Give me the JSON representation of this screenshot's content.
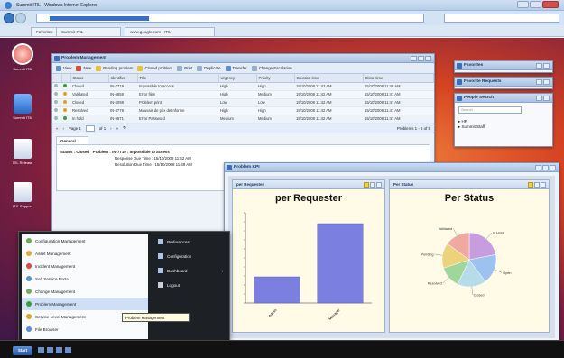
{
  "browser": {
    "title": "Summit ITIL - Windows Internet Explorer",
    "url": "http://www.example.com/summit",
    "search_placeholder": "Google",
    "tabs": [
      "Favorites",
      "Summit ITIL",
      "www.google.com - ITIL"
    ]
  },
  "desktop_icons": [
    {
      "label": "Summit ITIL",
      "kind": "orb"
    },
    {
      "label": "Summit ITIL",
      "kind": "man"
    },
    {
      "label": "ITIL Release",
      "kind": "sheet"
    },
    {
      "label": "ITIL Support",
      "kind": "sheet"
    }
  ],
  "problem_window": {
    "title": "Problem Management",
    "toolbar": [
      "View",
      "New",
      "Pending problem",
      "Closed problem",
      "Print",
      "Duplicate",
      "Transfer",
      "Change Escalation"
    ],
    "columns": [
      "",
      "",
      "Status",
      "Identifier",
      "Title",
      "Urgency",
      "Priority",
      "Creation time",
      "Close time"
    ],
    "rows": [
      {
        "dot": "#3a9e3a",
        "status": "Closed",
        "id": "IN-7719",
        "title": "Impossible to access",
        "urgency": "High",
        "priority": "High",
        "created": "15/10/2008 11:42 AM",
        "closed": "15/10/2008 11:48 AM"
      },
      {
        "dot": "#e0a020",
        "status": "Validated",
        "id": "IN-6858",
        "title": "Error files",
        "urgency": "High",
        "priority": "Medium",
        "created": "15/10/2008 11:42 AM",
        "closed": "15/10/2008 11:47 AM"
      },
      {
        "dot": "#e0a020",
        "status": "Closed",
        "id": "IN-5098",
        "title": "Problem print",
        "urgency": "Low",
        "priority": "Low",
        "created": "15/10/2008 11:42 AM",
        "closed": "15/10/2008 11:47 AM"
      },
      {
        "dot": "#e0a020",
        "status": "Resolved",
        "id": "IN-3778",
        "title": "Mauvais de prix de Informe",
        "urgency": "High",
        "priority": "High",
        "created": "15/10/2008 11:42 AM",
        "closed": "15/10/2008 11:47 AM"
      },
      {
        "dot": "#3a9e3a",
        "status": "In hold",
        "id": "IN-9671",
        "title": "Error Password",
        "urgency": "Medium",
        "priority": "Medium",
        "created": "15/10/2008 11:42 AM",
        "closed": "15/10/2008 11:47 AM"
      }
    ],
    "pager": {
      "page": "Page 1",
      "of": "of 1",
      "display": "Problems 1 - 5 of 5"
    },
    "general_tab": "General",
    "detail": {
      "status": "Status : Closed",
      "problem": "Problem : IN-7719 : Impossible to access",
      "response": "Response Due Time : 15/10/2008 11:42 AM",
      "resolution": "Resolution Due Time : 15/10/2008 11:48 AM"
    }
  },
  "right_widgets": [
    {
      "title": "Favorites"
    },
    {
      "title": "Favorite Requests"
    },
    {
      "title": "People Search",
      "search_placeholder": "Search",
      "results": [
        "HR",
        "Summit Staff"
      ]
    }
  ],
  "dashboard": {
    "title": "Problem KPI",
    "panel_left_title": "per Requester",
    "panel_right_title": "Per Status"
  },
  "chart_data": [
    {
      "type": "bar",
      "title": "per Requester",
      "categories": [
        "Admin",
        "Manager"
      ],
      "values": [
        2.9,
        8.8
      ],
      "ylim": [
        0,
        10
      ],
      "color": "#7b7fe0",
      "background": "#fffbe6"
    },
    {
      "type": "pie",
      "title": "Per Status",
      "labels": [
        "In Hold",
        "Open",
        "Closed",
        "Resolved",
        "Pending",
        "Validated"
      ],
      "values": [
        22,
        18,
        17,
        13,
        15,
        15
      ],
      "colors": [
        "#c89ddf",
        "#9ec2f0",
        "#b6dcea",
        "#9fd69a",
        "#ecd27a",
        "#f0a9a0"
      ]
    }
  ],
  "start_menu": {
    "left_items": [
      "Configuration Management",
      "Asset Management",
      "Incident Management",
      "Self Service Portal",
      "Change Management",
      "Problem Management",
      "Service Level Management",
      "File Browser"
    ],
    "active_index": 5,
    "right_items": [
      "Preferences",
      "Configuration",
      "Dashboard",
      "Logout"
    ]
  },
  "tooltip": "Problem Management",
  "taskbar": {
    "start_label": "Start"
  }
}
